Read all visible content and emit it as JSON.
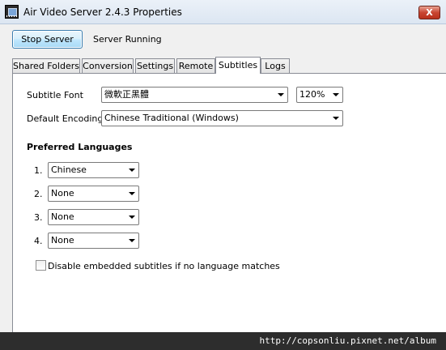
{
  "window": {
    "title": "Air Video Server 2.4.3 Properties",
    "close_label": "X"
  },
  "header": {
    "stop_button": "Stop Server",
    "status": "Server Running"
  },
  "tabs": [
    {
      "label": "Shared Folders",
      "active": false
    },
    {
      "label": "Conversion",
      "active": false
    },
    {
      "label": "Settings",
      "active": false
    },
    {
      "label": "Remote",
      "active": false
    },
    {
      "label": "Subtitles",
      "active": true
    },
    {
      "label": "Logs",
      "active": false
    }
  ],
  "subtitles": {
    "font_label": "Subtitle Font",
    "font_value": "微軟正黑體",
    "size_value": "120%",
    "encoding_label": "Default Encoding",
    "encoding_value": "Chinese Traditional (Windows)",
    "preferred_title": "Preferred Languages",
    "languages": [
      {
        "index": "1.",
        "value": "Chinese"
      },
      {
        "index": "2.",
        "value": "None"
      },
      {
        "index": "3.",
        "value": "None"
      },
      {
        "index": "4.",
        "value": "None"
      }
    ],
    "disable_embedded_label": "Disable embedded subtitles if no language matches",
    "disable_embedded_checked": false
  },
  "watermark": "http://copsonliu.pixnet.net/album"
}
